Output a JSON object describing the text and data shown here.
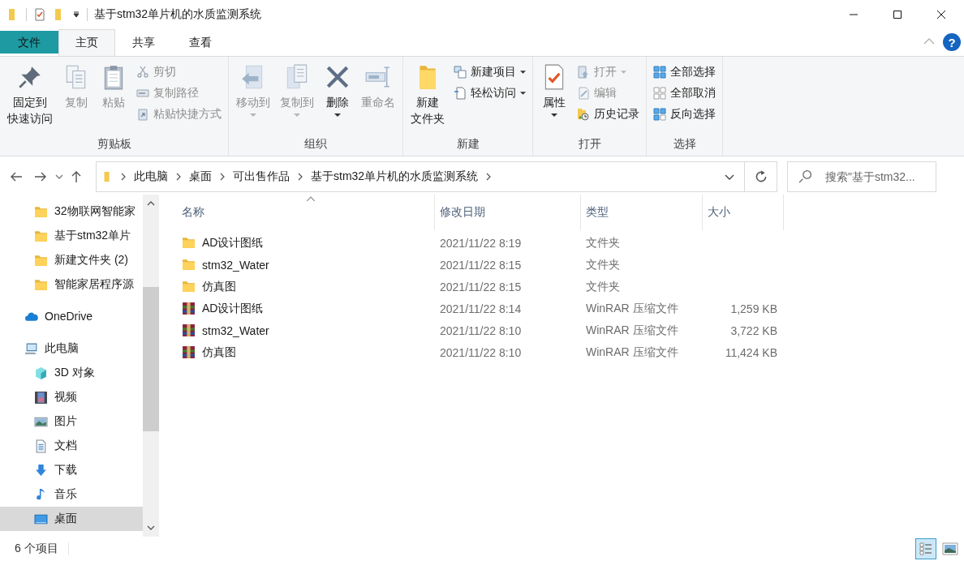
{
  "title_bar": {
    "title": "基于stm32单片机的水质监测系统"
  },
  "ribbon_tabs": [
    {
      "label": "文件",
      "kind": "file",
      "selected": false
    },
    {
      "label": "主页",
      "kind": "tab",
      "selected": true
    },
    {
      "label": "共享",
      "kind": "tab",
      "selected": false
    },
    {
      "label": "查看",
      "kind": "tab",
      "selected": false
    }
  ],
  "help_button": "?",
  "ribbon_groups": [
    {
      "label": "剪贴板",
      "columns": [
        {
          "kind": "large",
          "items": [
            {
              "lines": [
                "固定到",
                "快速访问"
              ],
              "disabled": false,
              "dropdown": false
            }
          ]
        },
        {
          "kind": "large",
          "items": [
            {
              "lines": [
                "复制"
              ],
              "disabled": true,
              "dropdown": false
            }
          ]
        },
        {
          "kind": "large",
          "items": [
            {
              "lines": [
                "粘贴"
              ],
              "disabled": true,
              "dropdown": false
            }
          ]
        },
        {
          "kind": "small",
          "items": [
            {
              "label": "剪切",
              "disabled": true,
              "dropdown": false
            },
            {
              "label": "复制路径",
              "disabled": true,
              "dropdown": false
            },
            {
              "label": "粘贴快捷方式",
              "disabled": true,
              "dropdown": false
            }
          ]
        }
      ]
    },
    {
      "label": "组织",
      "columns": [
        {
          "kind": "large",
          "items": [
            {
              "lines": [
                "移动到"
              ],
              "disabled": true,
              "dropdown": true
            }
          ]
        },
        {
          "kind": "large",
          "items": [
            {
              "lines": [
                "复制到"
              ],
              "disabled": true,
              "dropdown": true
            }
          ]
        },
        {
          "kind": "large",
          "items": [
            {
              "lines": [
                "删除"
              ],
              "disabled": false,
              "dropdown": true
            }
          ]
        },
        {
          "kind": "large",
          "items": [
            {
              "lines": [
                "重命名"
              ],
              "disabled": true,
              "dropdown": false
            }
          ]
        }
      ]
    },
    {
      "label": "新建",
      "columns": [
        {
          "kind": "large",
          "items": [
            {
              "lines": [
                "新建",
                "文件夹"
              ],
              "disabled": false,
              "dropdown": false
            }
          ]
        },
        {
          "kind": "small",
          "items": [
            {
              "label": "新建项目",
              "disabled": false,
              "dropdown": true
            },
            {
              "label": "轻松访问",
              "disabled": false,
              "dropdown": true
            }
          ]
        }
      ]
    },
    {
      "label": "打开",
      "columns": [
        {
          "kind": "large",
          "items": [
            {
              "lines": [
                "属性"
              ],
              "disabled": false,
              "dropdown": true
            }
          ]
        },
        {
          "kind": "small",
          "items": [
            {
              "label": "打开",
              "disabled": true,
              "dropdown": true
            },
            {
              "label": "编辑",
              "disabled": true,
              "dropdown": false
            },
            {
              "label": "历史记录",
              "disabled": false,
              "dropdown": false
            }
          ]
        }
      ]
    },
    {
      "label": "选择",
      "columns": [
        {
          "kind": "small",
          "items": [
            {
              "label": "全部选择",
              "disabled": false,
              "dropdown": false
            },
            {
              "label": "全部取消",
              "disabled": false,
              "dropdown": false
            },
            {
              "label": "反向选择",
              "disabled": false,
              "dropdown": false
            }
          ]
        }
      ]
    }
  ],
  "address_bar": {
    "segments": [
      "此电脑",
      "桌面",
      "可出售作品",
      "基于stm32单片机的水质监测系统"
    ]
  },
  "search": {
    "placeholder": "搜索\"基于stm32..."
  },
  "navigation": {
    "quick_access": [
      {
        "label": "32物联网智能家",
        "kind": "folder",
        "selected": false
      },
      {
        "label": "基于stm32单片",
        "kind": "folder",
        "selected": false
      },
      {
        "label": "新建文件夹 (2)",
        "kind": "folder",
        "selected": false
      },
      {
        "label": "智能家居程序源",
        "kind": "folder",
        "selected": false
      }
    ],
    "tree": [
      {
        "label": "OneDrive",
        "kind": "cloud",
        "selected": false
      },
      {
        "label": "此电脑",
        "kind": "pc",
        "selected": false,
        "children": [
          {
            "label": "3D 对象",
            "kind": "objects3d",
            "selected": false
          },
          {
            "label": "视频",
            "kind": "video",
            "selected": false
          },
          {
            "label": "图片",
            "kind": "pictures",
            "selected": false
          },
          {
            "label": "文档",
            "kind": "documents",
            "selected": false
          },
          {
            "label": "下载",
            "kind": "downloads",
            "selected": false
          },
          {
            "label": "音乐",
            "kind": "music",
            "selected": false
          },
          {
            "label": "桌面",
            "kind": "desktop",
            "selected": true
          }
        ]
      }
    ]
  },
  "file_list": {
    "columns": [
      {
        "label": "名称",
        "sorted": true
      },
      {
        "label": "修改日期",
        "sorted": false
      },
      {
        "label": "类型",
        "sorted": false
      },
      {
        "label": "大小",
        "sorted": false
      }
    ],
    "rows": [
      {
        "name": "AD设计图纸",
        "modified": "2021/11/22 8:19",
        "type": "文件夹",
        "kind": "folder"
      },
      {
        "name": "stm32_Water",
        "modified": "2021/11/22 8:15",
        "type": "文件夹",
        "kind": "folder"
      },
      {
        "name": "仿真图",
        "modified": "2021/11/22 8:15",
        "type": "文件夹",
        "kind": "folder"
      },
      {
        "name": "AD设计图纸",
        "modified": "2021/11/22 8:14",
        "type": "WinRAR 压缩文件",
        "size": "1,259 KB",
        "kind": "archive"
      },
      {
        "name": "stm32_Water",
        "modified": "2021/11/22 8:10",
        "type": "WinRAR 压缩文件",
        "size": "3,722 KB",
        "kind": "archive"
      },
      {
        "name": "仿真图",
        "modified": "2021/11/22 8:10",
        "type": "WinRAR 压缩文件",
        "size": "11,424 KB",
        "kind": "archive"
      }
    ]
  },
  "status_bar": {
    "item_count": "6 个项目",
    "views": [
      {
        "kind": "details",
        "selected": true
      },
      {
        "kind": "large_icons",
        "selected": false
      }
    ]
  }
}
